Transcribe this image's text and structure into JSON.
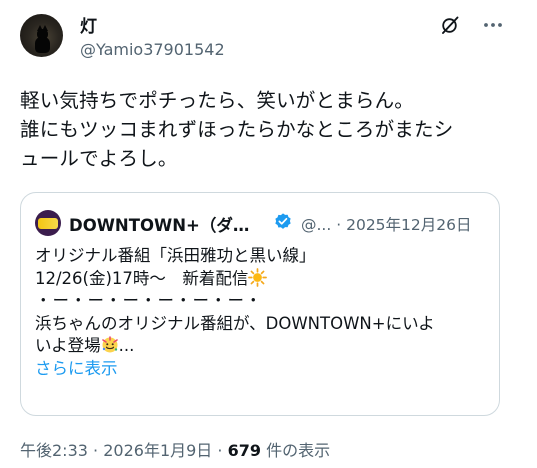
{
  "author": {
    "display_name": "灯",
    "handle": "@Yamio37901542"
  },
  "tweet": {
    "lines": [
      "軽い気持ちでポチったら、笑いがとまらん。",
      "誰にもツッコまれずほったらかなところがまたシ",
      "ュールでよろし。"
    ]
  },
  "quote": {
    "display_name": "DOWNTOWN+（ダ…",
    "handle_short": "@...",
    "separator": "·",
    "date": "2025年12月26日",
    "body_lines": [
      "オリジナル番組「浜田雅功と黒い線」",
      "12/26(金)17時～　新着配信",
      "・ー・ー・ー・ー・ー・ー・",
      "浜ちゃんのオリジナル番組が、DOWNTOWN+にいよ",
      "いよ登場",
      "..."
    ],
    "show_more": "さらに表示"
  },
  "footer": {
    "time": "午後2:33",
    "sep1": "·",
    "date": "2026年1月9日",
    "sep2": "·",
    "views_count": "679",
    "views_label": "件の表示"
  },
  "colors": {
    "text": "#0f1419",
    "secondary": "#536471",
    "link": "#1d9bf0",
    "border": "#cfd9de",
    "verified": "#1d9bf0"
  },
  "icons": {
    "grok": "grok-slash-icon",
    "more": "more-dots-icon",
    "verified": "verified-badge-icon",
    "sun": "sun-emoji-icon",
    "celebrate": "celebration-emoji-icon"
  }
}
